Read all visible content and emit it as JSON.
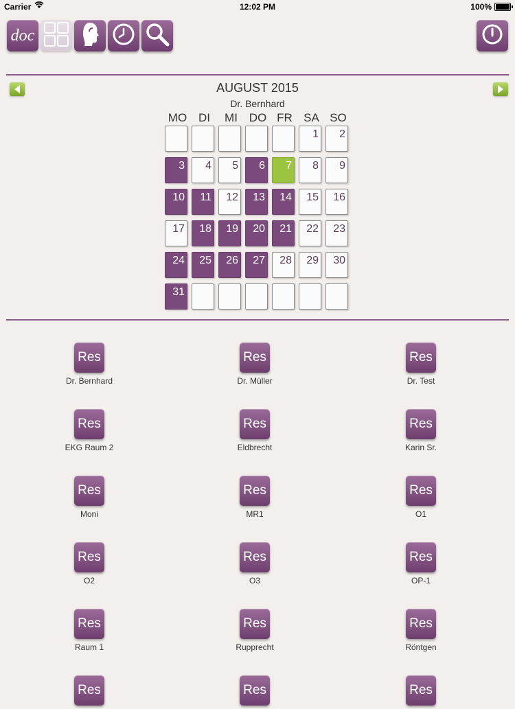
{
  "status_bar": {
    "carrier": "Carrier",
    "time": "12:02 PM",
    "battery": "100%"
  },
  "toolbar": {
    "doc_label": "doc"
  },
  "calendar": {
    "month": "AUGUST 2015",
    "doctor": "Dr. Bernhard",
    "weekdays": [
      "MO",
      "DI",
      "MI",
      "DO",
      "FR",
      "SA",
      "SO"
    ],
    "weeks": [
      [
        "",
        "",
        "",
        "",
        "",
        "1",
        "2"
      ],
      [
        "3",
        "4",
        "5",
        "6",
        "7",
        "8",
        "9"
      ],
      [
        "10",
        "11",
        "12",
        "13",
        "14",
        "15",
        "16"
      ],
      [
        "17",
        "18",
        "19",
        "20",
        "21",
        "22",
        "23"
      ],
      [
        "24",
        "25",
        "26",
        "27",
        "28",
        "29",
        "30"
      ],
      [
        "31",
        "",
        "",
        "",
        "",
        "",
        ""
      ]
    ],
    "booked_days": [
      "3",
      "6",
      "10",
      "11",
      "13",
      "14",
      "18",
      "19",
      "20",
      "21",
      "24",
      "25",
      "26",
      "27",
      "31"
    ],
    "today": "7",
    "colors": {
      "booked": "#7b4a7c",
      "today": "#9cc43f"
    }
  },
  "resources": {
    "button_label": "Res",
    "items": [
      "Dr. Bernhard",
      "Dr. Müller",
      "Dr. Test",
      "EKG Raum 2",
      "Eldbrecht",
      "Karin Sr.",
      "Moni",
      "MR1",
      "O1",
      "O2",
      "O3",
      "OP-1",
      "Raum 1",
      "Rupprecht",
      "Röntgen",
      "",
      "",
      ""
    ]
  },
  "colors": {
    "accent": "#7b4a7c",
    "divider": "#8a5a89",
    "nav_arrow": "#9cc43f"
  }
}
